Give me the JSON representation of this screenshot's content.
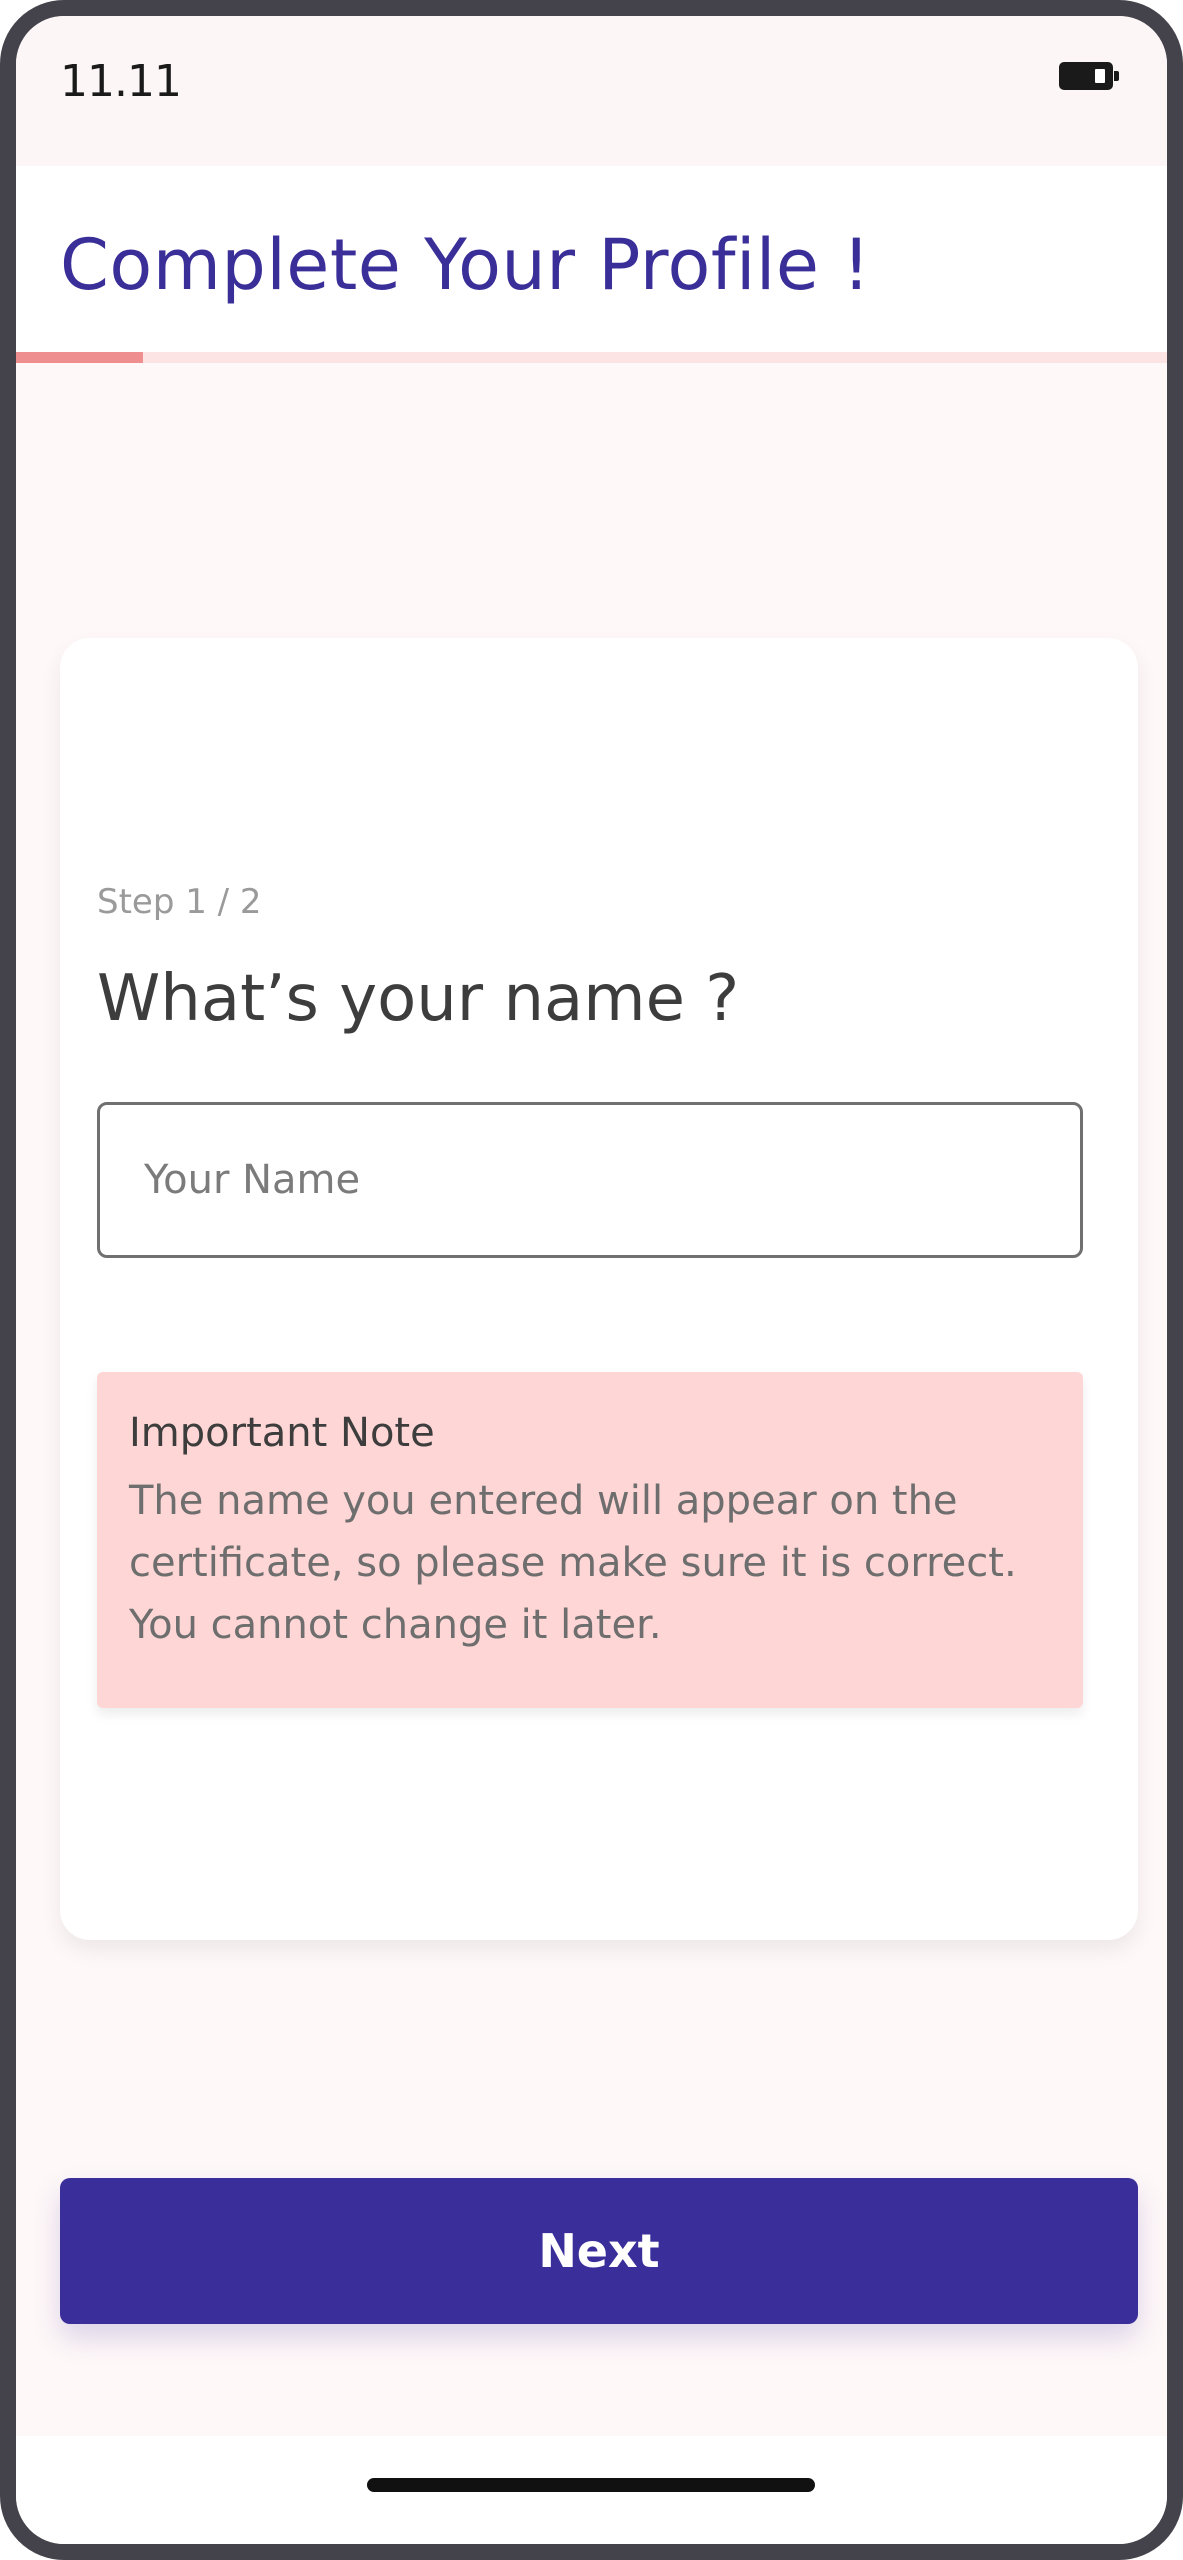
{
  "status_bar": {
    "time": "11.11",
    "battery_icon": "battery-low-icon",
    "battery_level": 0.25
  },
  "header": {
    "title": "Complete Your Profile !"
  },
  "progress": {
    "fraction": 0.11,
    "track_color": "#fde4e4",
    "fill_color": "#ef8e8e"
  },
  "form": {
    "step_label": "Step 1 / 2",
    "question": "What’s your name ?",
    "name_value": "",
    "name_placeholder": "Your Name"
  },
  "note": {
    "title": "Important Note",
    "body": "The name you entered will appear on the certificate, so please make sure it is correct. You cannot change it later."
  },
  "actions": {
    "next_label": "Next"
  },
  "colors": {
    "brand": "#392e9a",
    "title": "#3a2f98",
    "note_background": "#ffd6d6",
    "page_background": "#fff8f8"
  }
}
